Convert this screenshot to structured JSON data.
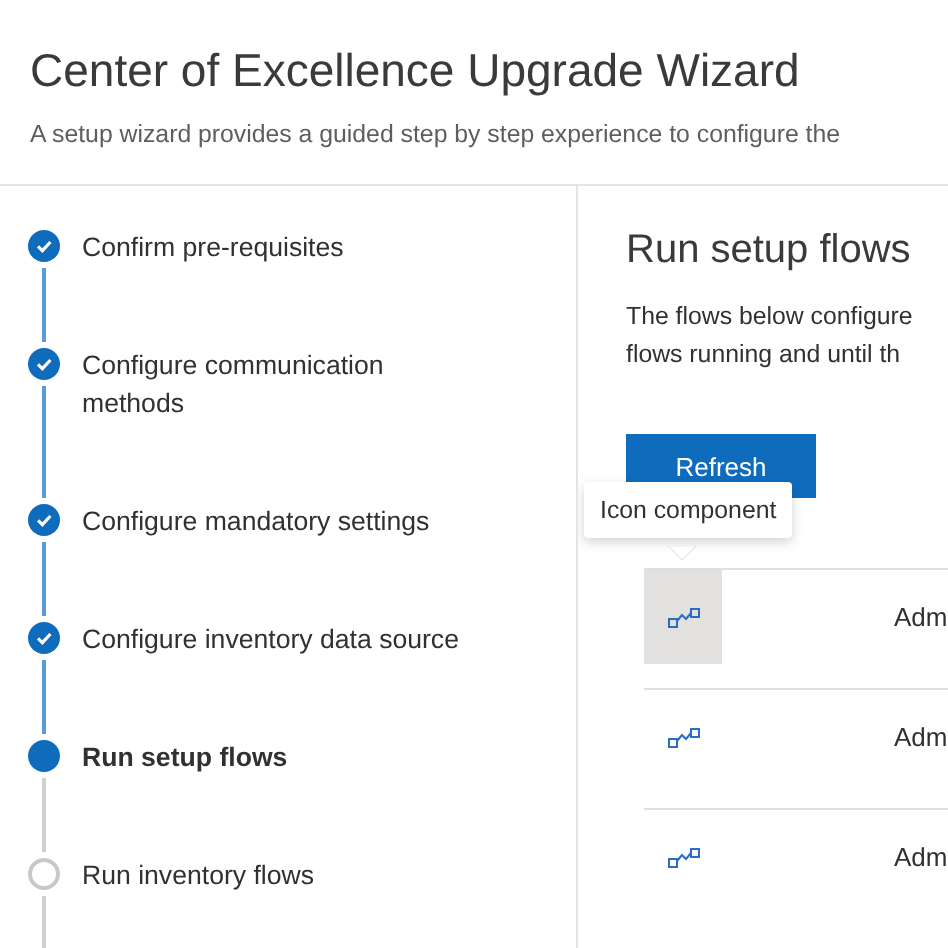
{
  "header": {
    "title": "Center of Excellence Upgrade Wizard",
    "subtitle": "A setup wizard provides a guided step by step experience to configure the"
  },
  "steps": [
    {
      "label": "Confirm pre-requisites",
      "kind": "completed"
    },
    {
      "label": "Configure communication methods",
      "kind": "completed"
    },
    {
      "label": "Configure mandatory settings",
      "kind": "completed"
    },
    {
      "label": "Configure inventory data source",
      "kind": "completed"
    },
    {
      "label": "Run setup flows",
      "kind": "current"
    },
    {
      "label": "Run inventory flows",
      "kind": "pending"
    }
  ],
  "content": {
    "title": "Run setup flows",
    "description_lines": [
      "The flows below configure",
      "flows running and until th"
    ],
    "refresh_button": "Refresh",
    "tooltip": "Icon component",
    "flows": [
      {
        "name": "Adm",
        "hovered": true
      },
      {
        "name": "Adm",
        "hovered": false
      },
      {
        "name": "Adm",
        "hovered": false
      }
    ]
  }
}
